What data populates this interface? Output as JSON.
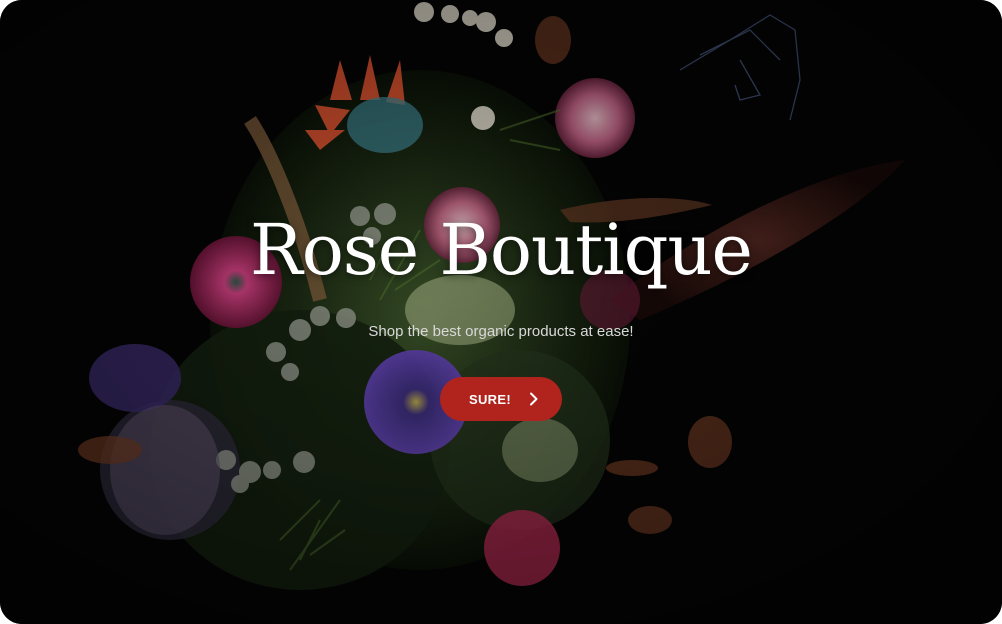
{
  "hero": {
    "title": "Rose Boutique",
    "subtitle": "Shop the best organic products at ease!",
    "cta_label": "SURE!",
    "cta_icon": "chevron-right-icon",
    "background_image": "dark floral bouquet with roses, anemones, ferns, berries, feathers and a bird",
    "colors": {
      "background": "#050505",
      "accent": "#b0241d",
      "title": "#ffffff",
      "subtitle": "#d9d9d9"
    }
  }
}
